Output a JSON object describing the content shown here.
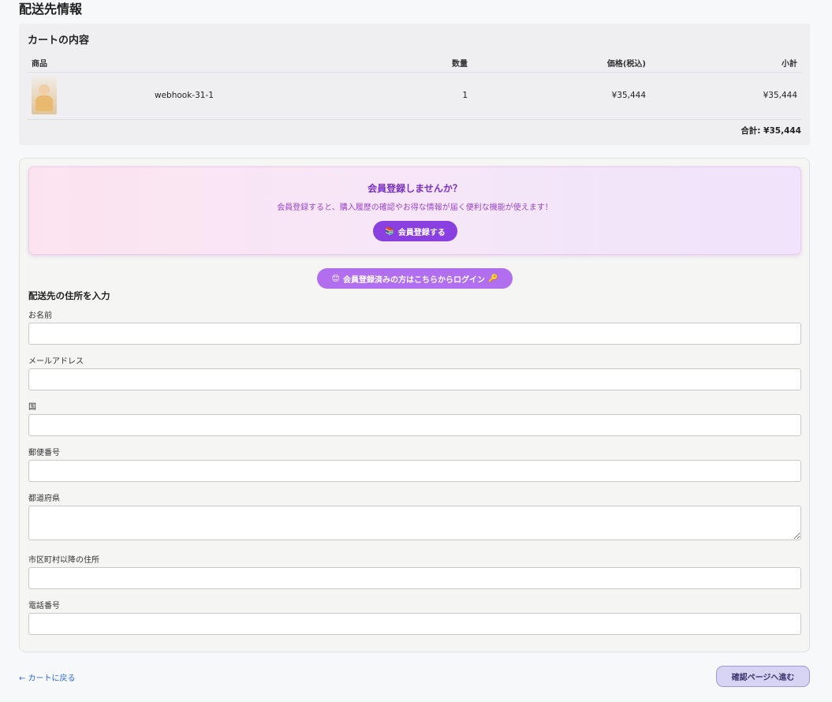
{
  "page": {
    "title": "配送先情報"
  },
  "cart": {
    "title": "カートの内容",
    "headers": {
      "product": "商品",
      "qty": "数量",
      "price": "価格(税込)",
      "subtotal": "小計"
    },
    "items": [
      {
        "name": "webhook-31-1",
        "qty": "1",
        "price": "¥35,444",
        "subtotal": "¥35,444"
      }
    ],
    "total": "合計: ¥35,444"
  },
  "promo": {
    "title": "会員登録しませんか？",
    "text": "会員登録すると、購入履歴の確認やお得な情報が届く便利な機能が使えます！",
    "button_icon": "📚",
    "button_label": "会員登録する"
  },
  "login": {
    "icon_left": "😊",
    "label": "会員登録済みの方はこちらからログイン",
    "icon_right": "🔑"
  },
  "form": {
    "title": "配送先の住所を入力",
    "fields": [
      {
        "label": "お名前",
        "value": ""
      },
      {
        "label": "メールアドレス",
        "value": ""
      },
      {
        "label": "国",
        "value": ""
      },
      {
        "label": "郵便番号",
        "value": ""
      },
      {
        "label": "都道府県",
        "value": ""
      },
      {
        "label": "市区町村以降の住所",
        "value": ""
      },
      {
        "label": "電話番号",
        "value": ""
      }
    ]
  },
  "footer": {
    "back_link": "← カートに戻る",
    "next_button": "確認ページへ進む"
  },
  "colors": {
    "accent": "#8a3fe0",
    "login_button": "#b16ff0",
    "next_button": "#d7d4f3",
    "link": "#2f6bd6"
  }
}
